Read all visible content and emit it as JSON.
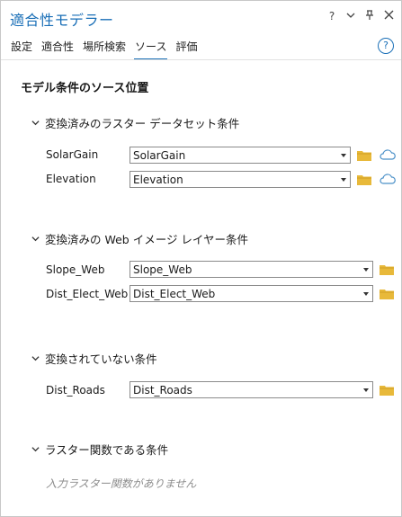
{
  "window": {
    "title": "適合性モデラー",
    "controls": {
      "help": "?",
      "menu": "⌄",
      "pin": "📌",
      "close": "✕"
    }
  },
  "tabs": [
    {
      "label": "設定",
      "active": false
    },
    {
      "label": "適合性",
      "active": false
    },
    {
      "label": "場所検索",
      "active": false
    },
    {
      "label": "ソース",
      "active": true
    },
    {
      "label": "評価",
      "active": false
    }
  ],
  "help_icon": "?",
  "panel_title": "モデル条件のソース位置",
  "sections": {
    "converted_raster": {
      "heading": "変換済みのラスター データセット条件",
      "rows": [
        {
          "label": "SolarGain",
          "value": "SolarGain"
        },
        {
          "label": "Elevation",
          "value": "Elevation"
        }
      ]
    },
    "converted_web": {
      "heading": "変換済みの Web イメージ レイヤー条件",
      "rows": [
        {
          "label": "Slope_Web",
          "value": "Slope_Web"
        },
        {
          "label": "Dist_Elect_Web",
          "value": "Dist_Elect_Web"
        }
      ]
    },
    "unconverted": {
      "heading": "変換されていない条件",
      "rows": [
        {
          "label": "Dist_Roads",
          "value": "Dist_Roads"
        }
      ]
    },
    "raster_function": {
      "heading": "ラスター関数である条件",
      "empty_text": "入力ラスター関数がありません"
    }
  },
  "colors": {
    "accent": "#1a6fb7",
    "folder": "#e8b93a",
    "cloud": "#4a90c8"
  },
  "icons": [
    "folder-icon",
    "cloud-icon",
    "chevron-down-icon",
    "help-icon",
    "pin-icon",
    "close-icon"
  ]
}
